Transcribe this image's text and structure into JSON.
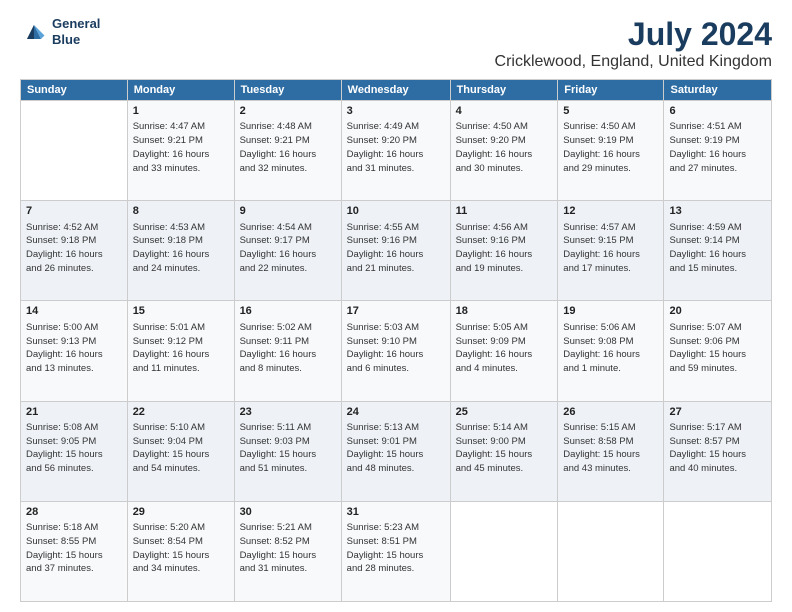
{
  "header": {
    "logo_line1": "General",
    "logo_line2": "Blue",
    "title": "July 2024",
    "subtitle": "Cricklewood, England, United Kingdom"
  },
  "columns": [
    "Sunday",
    "Monday",
    "Tuesday",
    "Wednesday",
    "Thursday",
    "Friday",
    "Saturday"
  ],
  "weeks": [
    [
      {
        "day": "",
        "info": ""
      },
      {
        "day": "1",
        "info": "Sunrise: 4:47 AM\nSunset: 9:21 PM\nDaylight: 16 hours\nand 33 minutes."
      },
      {
        "day": "2",
        "info": "Sunrise: 4:48 AM\nSunset: 9:21 PM\nDaylight: 16 hours\nand 32 minutes."
      },
      {
        "day": "3",
        "info": "Sunrise: 4:49 AM\nSunset: 9:20 PM\nDaylight: 16 hours\nand 31 minutes."
      },
      {
        "day": "4",
        "info": "Sunrise: 4:50 AM\nSunset: 9:20 PM\nDaylight: 16 hours\nand 30 minutes."
      },
      {
        "day": "5",
        "info": "Sunrise: 4:50 AM\nSunset: 9:19 PM\nDaylight: 16 hours\nand 29 minutes."
      },
      {
        "day": "6",
        "info": "Sunrise: 4:51 AM\nSunset: 9:19 PM\nDaylight: 16 hours\nand 27 minutes."
      }
    ],
    [
      {
        "day": "7",
        "info": "Sunrise: 4:52 AM\nSunset: 9:18 PM\nDaylight: 16 hours\nand 26 minutes."
      },
      {
        "day": "8",
        "info": "Sunrise: 4:53 AM\nSunset: 9:18 PM\nDaylight: 16 hours\nand 24 minutes."
      },
      {
        "day": "9",
        "info": "Sunrise: 4:54 AM\nSunset: 9:17 PM\nDaylight: 16 hours\nand 22 minutes."
      },
      {
        "day": "10",
        "info": "Sunrise: 4:55 AM\nSunset: 9:16 PM\nDaylight: 16 hours\nand 21 minutes."
      },
      {
        "day": "11",
        "info": "Sunrise: 4:56 AM\nSunset: 9:16 PM\nDaylight: 16 hours\nand 19 minutes."
      },
      {
        "day": "12",
        "info": "Sunrise: 4:57 AM\nSunset: 9:15 PM\nDaylight: 16 hours\nand 17 minutes."
      },
      {
        "day": "13",
        "info": "Sunrise: 4:59 AM\nSunset: 9:14 PM\nDaylight: 16 hours\nand 15 minutes."
      }
    ],
    [
      {
        "day": "14",
        "info": "Sunrise: 5:00 AM\nSunset: 9:13 PM\nDaylight: 16 hours\nand 13 minutes."
      },
      {
        "day": "15",
        "info": "Sunrise: 5:01 AM\nSunset: 9:12 PM\nDaylight: 16 hours\nand 11 minutes."
      },
      {
        "day": "16",
        "info": "Sunrise: 5:02 AM\nSunset: 9:11 PM\nDaylight: 16 hours\nand 8 minutes."
      },
      {
        "day": "17",
        "info": "Sunrise: 5:03 AM\nSunset: 9:10 PM\nDaylight: 16 hours\nand 6 minutes."
      },
      {
        "day": "18",
        "info": "Sunrise: 5:05 AM\nSunset: 9:09 PM\nDaylight: 16 hours\nand 4 minutes."
      },
      {
        "day": "19",
        "info": "Sunrise: 5:06 AM\nSunset: 9:08 PM\nDaylight: 16 hours\nand 1 minute."
      },
      {
        "day": "20",
        "info": "Sunrise: 5:07 AM\nSunset: 9:06 PM\nDaylight: 15 hours\nand 59 minutes."
      }
    ],
    [
      {
        "day": "21",
        "info": "Sunrise: 5:08 AM\nSunset: 9:05 PM\nDaylight: 15 hours\nand 56 minutes."
      },
      {
        "day": "22",
        "info": "Sunrise: 5:10 AM\nSunset: 9:04 PM\nDaylight: 15 hours\nand 54 minutes."
      },
      {
        "day": "23",
        "info": "Sunrise: 5:11 AM\nSunset: 9:03 PM\nDaylight: 15 hours\nand 51 minutes."
      },
      {
        "day": "24",
        "info": "Sunrise: 5:13 AM\nSunset: 9:01 PM\nDaylight: 15 hours\nand 48 minutes."
      },
      {
        "day": "25",
        "info": "Sunrise: 5:14 AM\nSunset: 9:00 PM\nDaylight: 15 hours\nand 45 minutes."
      },
      {
        "day": "26",
        "info": "Sunrise: 5:15 AM\nSunset: 8:58 PM\nDaylight: 15 hours\nand 43 minutes."
      },
      {
        "day": "27",
        "info": "Sunrise: 5:17 AM\nSunset: 8:57 PM\nDaylight: 15 hours\nand 40 minutes."
      }
    ],
    [
      {
        "day": "28",
        "info": "Sunrise: 5:18 AM\nSunset: 8:55 PM\nDaylight: 15 hours\nand 37 minutes."
      },
      {
        "day": "29",
        "info": "Sunrise: 5:20 AM\nSunset: 8:54 PM\nDaylight: 15 hours\nand 34 minutes."
      },
      {
        "day": "30",
        "info": "Sunrise: 5:21 AM\nSunset: 8:52 PM\nDaylight: 15 hours\nand 31 minutes."
      },
      {
        "day": "31",
        "info": "Sunrise: 5:23 AM\nSunset: 8:51 PM\nDaylight: 15 hours\nand 28 minutes."
      },
      {
        "day": "",
        "info": ""
      },
      {
        "day": "",
        "info": ""
      },
      {
        "day": "",
        "info": ""
      }
    ]
  ]
}
